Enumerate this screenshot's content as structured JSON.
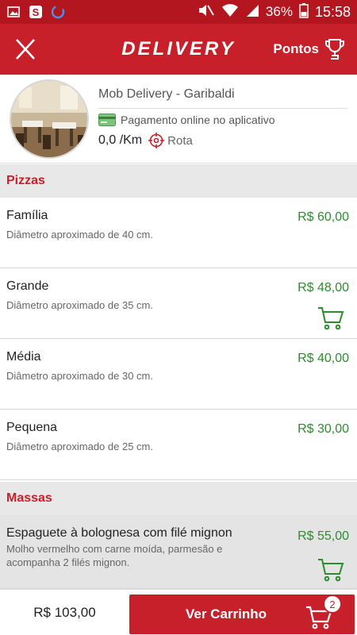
{
  "status_bar": {
    "battery": "36%",
    "time": "15:58",
    "icons": [
      "image-icon",
      "s-app-icon",
      "sync-circle-icon",
      "mute-icon",
      "wifi-icon",
      "signal-icon",
      "battery-icon"
    ]
  },
  "app_bar": {
    "close_label": "X",
    "title": "DELIVERY",
    "points_label": "Pontos"
  },
  "store": {
    "name": "Mob Delivery - Garibaldi",
    "payment": "Pagamento online no aplicativo",
    "distance": "0,0 /Km",
    "route_label": "Rota"
  },
  "sections": [
    {
      "title": "Pizzas",
      "items": [
        {
          "name": "Família",
          "description": "Diâmetro aproximado de 40 cm.",
          "price": "R$ 60,00",
          "in_cart": false
        },
        {
          "name": "Grande",
          "description": "Diâmetro aproximado de 35 cm.",
          "price": "R$ 48,00",
          "in_cart": true
        },
        {
          "name": "Média",
          "description": "Diâmetro aproximado de 30 cm.",
          "price": "R$ 40,00",
          "in_cart": false
        },
        {
          "name": "Pequena",
          "description": "Diâmetro aproximado de 25 cm.",
          "price": "R$ 30,00",
          "in_cart": false
        }
      ]
    },
    {
      "title": "Massas",
      "items": [
        {
          "name": "Espaguete à bolognesa com filé mignon",
          "description": "Molho vermelho com carne moída, parmesão e acompanha 2 filés mignon.",
          "price": "R$ 55,00",
          "in_cart": true
        }
      ]
    }
  ],
  "footer": {
    "total": "R$ 103,00",
    "cart_button_label": "Ver Carrinho",
    "cart_count": "2"
  },
  "colors": {
    "brand_red": "#c8202a",
    "price_green": "#2e8b2e",
    "section_bg": "#e8e8e8"
  }
}
